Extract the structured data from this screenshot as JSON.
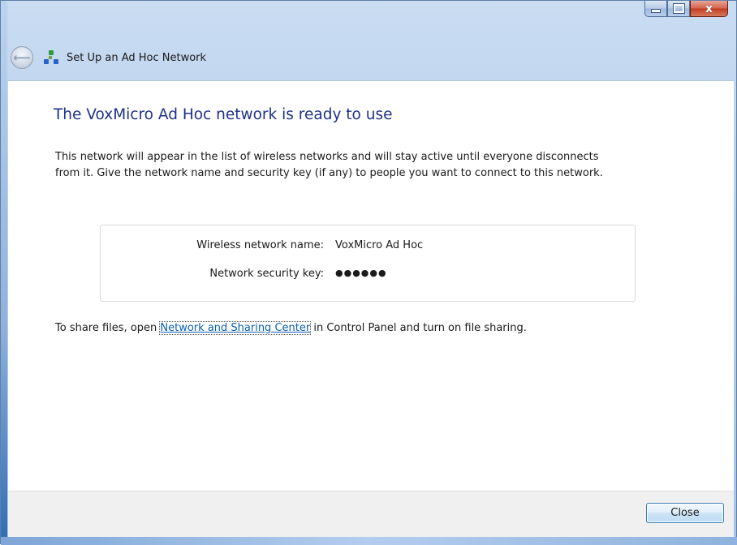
{
  "window": {
    "title": "Set Up an Ad Hoc Network",
    "caption_buttons": {
      "minimize": "minimize-icon",
      "maximize": "maximize-icon",
      "close": "x"
    }
  },
  "nav": {
    "back_icon": "back-arrow-icon",
    "back_glyph": "⟵"
  },
  "content": {
    "heading": "The VoxMicro Ad Hoc network is ready to use",
    "description": "This network will appear in the list of wireless networks and will stay active until everyone disconnects from it. Give the network name and security key (if any) to people you want to connect to this network.",
    "info": {
      "name_label": "Wireless network name:",
      "name_value": "VoxMicro Ad Hoc",
      "key_label": "Network security key:",
      "key_value": "●●●●●●"
    },
    "share": {
      "prefix": "To share files, open ",
      "link": "Network and Sharing Center",
      "suffix": " in Control Panel and turn on file sharing."
    }
  },
  "footer": {
    "close_label": "Close"
  },
  "colors": {
    "heading": "#1e3287",
    "link": "#0b5fb5",
    "close_caption": "#c23b22"
  }
}
